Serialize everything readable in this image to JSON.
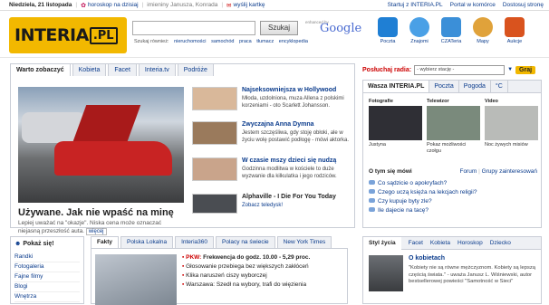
{
  "topbar": {
    "date": "Niedziela, 21 listopada",
    "horoscope": "horoskop na dzisiaj",
    "nameday": "imieniny Janusza, Konrada",
    "card": "wyślij kartkę",
    "links": [
      "Startuj z INTERIA.PL",
      "Portal w komórce",
      "Dostosuj stronę"
    ]
  },
  "logo": {
    "text": "INTERIA",
    "suffix": ".PL"
  },
  "search": {
    "value": "",
    "button": "Szukaj",
    "enhanced": "enhanced by",
    "google": "Google",
    "categories": [
      "Szukaj również:",
      "nieruchomości",
      "samochód",
      "praca",
      "tłumacz",
      "encyklopedia"
    ]
  },
  "services": [
    {
      "label": "Poczta",
      "color": "#1f7fd4"
    },
    {
      "label": "Znajomi",
      "color": "#4aa0e6"
    },
    {
      "label": "CZATeria",
      "color": "#3b8fd8"
    },
    {
      "label": "Mapy",
      "color": "#e0a23a"
    },
    {
      "label": "Aukcje",
      "color": "#d9531e"
    }
  ],
  "main": {
    "tabs": [
      "Warto zobaczyć",
      "Kobieta",
      "Facet",
      "Interia.tv",
      "Podróże"
    ],
    "lead": {
      "title": "Używane. Jak nie wpaść na minę",
      "text": "Lepiej uważać na \"okazje\". Niska cena może oznaczać niejasną przeszłość auta.",
      "more": "więcej"
    },
    "stories": [
      {
        "title": "Najseksowniejsza w Hollywood",
        "text": "Młoda, uzdolniona, muza Allena z polskimi korzeniami - oto Scarlett Johansson.",
        "color": "#d9b89a"
      },
      {
        "title": "Zwyczajna Anna Dymna",
        "text": "Jestem szczęśliwa, gdy stoję obłoki, ale w życiu wolę postawić podłogę - mówi aktorka.",
        "color": "#9a7a5c"
      },
      {
        "title": "W czasie mszy dzieci się nudzą",
        "text": "Godzinna modlitwa w kościele to duże wyzwanie dla kilkulatka i jego rodziców.",
        "color": "#c9a48b"
      },
      {
        "title": "Alphaville - I Die For You Today",
        "text": "Zobacz teledysk!",
        "color": "#4a4d52"
      }
    ]
  },
  "radio": {
    "label": "Posłuchaj radia:",
    "placeholder": "- wybierz stację -",
    "go": "Graj"
  },
  "side": {
    "tabs": [
      "Wasza INTERIA.PL",
      "Poczta",
      "Pogoda",
      "°C"
    ],
    "videos": [
      {
        "head": "Fotografie",
        "caption": "Justyna",
        "color": "#2f2f35"
      },
      {
        "head": "Telewizor",
        "caption": "Pokaz możliwości czołgu",
        "color": "#7a8a7c"
      },
      {
        "head": "Video",
        "caption": "Noc żywych misiów",
        "color": "#b9bbb8"
      }
    ],
    "talk": {
      "title": "O tym się mówi",
      "forum": "Forum",
      "groups": "Grupy zainteresowań",
      "items": [
        "Co sądzicie o apokryfach?",
        "Czego uczą księża na lekcjach religii?",
        "Czy kupuje byty zle?",
        "Ile dajecie na tacę?"
      ]
    }
  },
  "bottom": {
    "left": {
      "title": "Pokaż się!",
      "items": [
        "Randki",
        "Fotogaleria",
        "Fajne filmy",
        "Blogi",
        "Wnętrza"
      ]
    },
    "mid": {
      "tabs": [
        "Fakty",
        "Polska Lokalna",
        "Interia360",
        "Polacy na świecie",
        "New York Times"
      ],
      "items": [
        {
          "prefix": "PKW:",
          "text": "Frekwencja do godz. 10.00 - 5,29 proc."
        },
        {
          "prefix": "",
          "text": "Głosowanie przebiega bez większych zakłóceń"
        },
        {
          "prefix": "",
          "text": "Klika naruszeń ciszy wyborczej"
        },
        {
          "prefix": "",
          "text": "Warszawa: Szedł na wybory, trafi do więzienia"
        }
      ]
    },
    "right": {
      "title": "Styl życia",
      "links": [
        "Facet",
        "Kobieta",
        "Horoskop",
        "Dziecko"
      ],
      "story": {
        "title": "O kobietach",
        "text": "\"Kobiety nie są równe mężczyznom. Kobiety są lepszą częścią świata.\" - uważa Janusz L. Wiśniewski, autor bestsellerowej powieści \"Samotność w Sieci\""
      }
    }
  }
}
